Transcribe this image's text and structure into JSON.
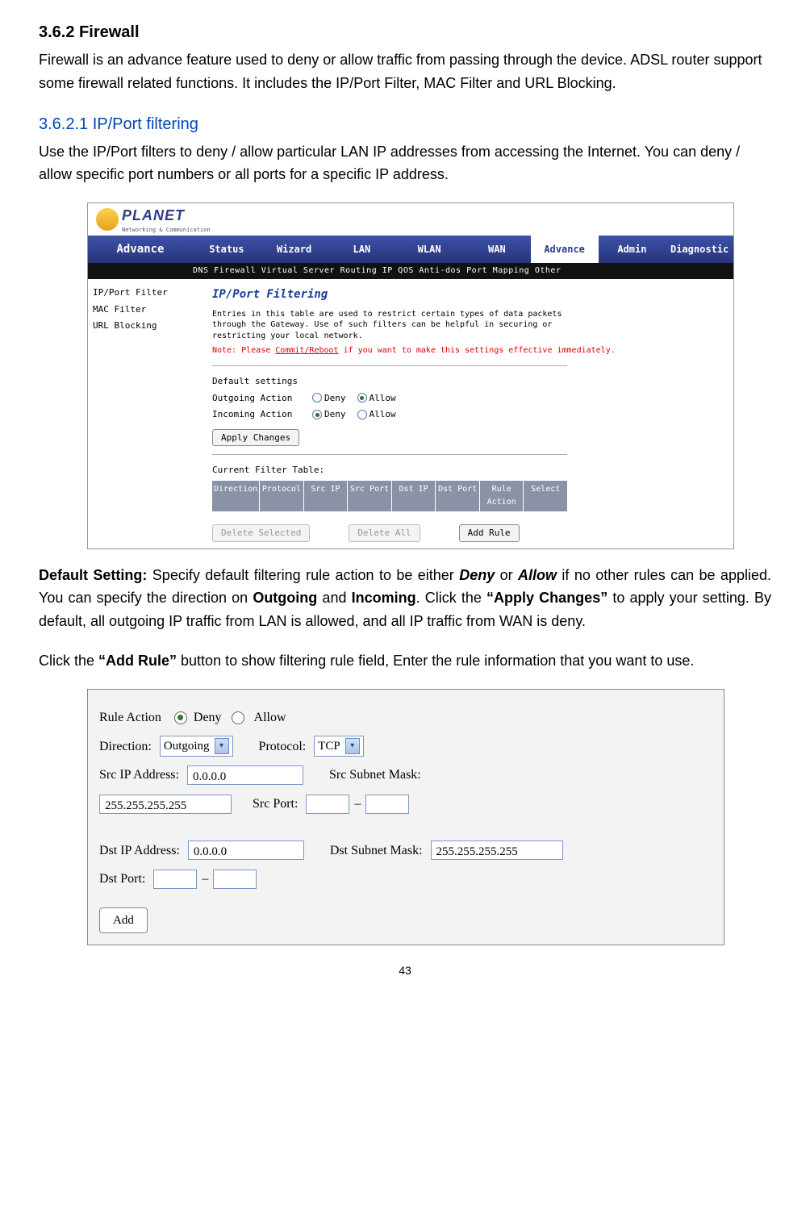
{
  "section": {
    "heading": "3.6.2 Firewall",
    "para": "Firewall is an advance feature used to deny or allow traffic from passing through the device. ADSL router support some firewall related functions. It includes the IP/Port Filter, MAC Filter and URL Blocking."
  },
  "subsection": {
    "heading": "3.6.2.1 IP/Port filtering",
    "para": "Use the IP/Port filters to deny / allow particular LAN IP addresses from accessing the Internet. You can deny / allow specific port numbers or all ports for a specific IP address."
  },
  "screenshot1": {
    "logo_name": "PLANET",
    "logo_sub": "Networking & Communication",
    "nav_title": "Advance",
    "tabs": [
      "Status",
      "Wizard",
      "LAN",
      "WLAN",
      "WAN",
      "Advance",
      "Admin",
      "Diagnostic"
    ],
    "active_tab_index": 5,
    "subnav": "DNS  Firewall  Virtual Server  Routing  IP QOS  Anti-dos  Port Mapping  Other",
    "side_items": [
      "IP/Port Filter",
      "MAC Filter",
      "URL Blocking"
    ],
    "panel_title": "IP/Port Filtering",
    "panel_desc": "Entries in this table are used to restrict certain types of data packets through the Gateway. Use of such filters can be helpful in securing or restricting your local network.",
    "panel_note_prefix": "Note: Please ",
    "panel_note_link": "Commit/Reboot",
    "panel_note_suffix": " if you want to make this settings effective immediately.",
    "default_settings_label": "Default settings",
    "rows": [
      {
        "label": "Outgoing Action",
        "deny": "Deny",
        "allow": "Allow",
        "selected": "allow"
      },
      {
        "label": "Incoming Action",
        "deny": "Deny",
        "allow": "Allow",
        "selected": "deny"
      }
    ],
    "apply_btn": "Apply Changes",
    "table_label": "Current Filter Table:",
    "table_headers": [
      "Direction",
      "Protocol",
      "Src IP",
      "Src Port",
      "Dst IP",
      "Dst Port",
      "Rule Action",
      "Select"
    ],
    "btn_delete_sel": "Delete Selected",
    "btn_delete_all": "Delete All",
    "btn_add_rule": "Add Rule"
  },
  "para_default": {
    "prefix": "Default Setting: ",
    "t1": "Specify default filtering rule action to be either ",
    "deny": "Deny",
    "t2": " or ",
    "allow": "Allow",
    "t3": " if no other rules can be applied. You can specify the direction on ",
    "outgoing": "Outgoing",
    "t4": " and ",
    "incoming": "Incoming",
    "t5": ". Click the ",
    "apply": "“Apply Changes”",
    "t6": " to apply your setting. By default, all outgoing IP traffic from LAN is allowed, and all IP traffic from WAN is deny."
  },
  "para_addrule": {
    "t1": "Click the ",
    "bold": "“Add Rule”",
    "t2": " button to show filtering rule field, Enter the rule information that you want to use."
  },
  "screenshot2": {
    "rule_action_label": "Rule Action",
    "deny": "Deny",
    "allow": "Allow",
    "rule_action_selected": "deny",
    "direction_label": "Direction:",
    "direction_value": "Outgoing",
    "protocol_label": "Protocol:",
    "protocol_value": "TCP",
    "src_ip_label": "Src IP Address:",
    "src_ip_value": "0.0.0.0",
    "src_mask_label": "Src Subnet Mask:",
    "src_mask_value": "255.255.255.255",
    "src_port_label": "Src Port:",
    "src_port_from": "",
    "src_port_to": "",
    "dash": "–",
    "dst_ip_label": "Dst IP Address:",
    "dst_ip_value": "0.0.0.0",
    "dst_mask_label": "Dst Subnet Mask:",
    "dst_mask_value": "255.255.255.255",
    "dst_port_label": "Dst Port:",
    "dst_port_from": "",
    "dst_port_to": "",
    "add_btn": "Add"
  },
  "page_number": "43"
}
